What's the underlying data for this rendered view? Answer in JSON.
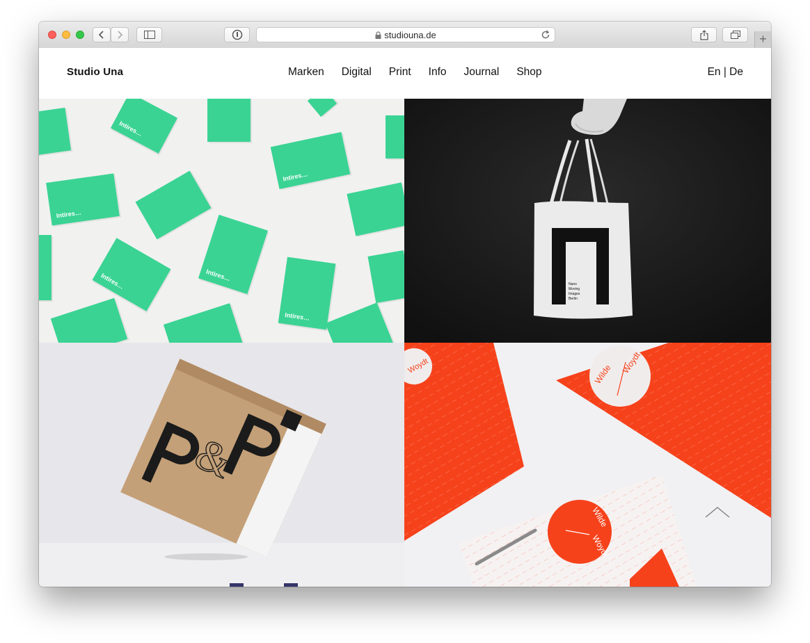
{
  "browser": {
    "url": "studiouna.de"
  },
  "site": {
    "logo": "Studio Una",
    "nav": [
      "Marken",
      "Digital",
      "Print",
      "Info",
      "Journal",
      "Shop"
    ],
    "lang": {
      "en": "En",
      "separator": " | ",
      "de": "De"
    }
  },
  "tiles": {
    "cards_text": "Intires…",
    "bag_text": [
      "Nano",
      "Moving",
      "Images",
      "Berlin"
    ],
    "bag_side": "nano",
    "circle_words": [
      "Wilde",
      "Woydt"
    ]
  },
  "colors": {
    "card_green": "#3ad393",
    "accent_orange": "#f6421b",
    "bag_black": "#111111",
    "box_kraft": "#c4a078"
  },
  "icons": {
    "scroll_top": "chevron-up-icon"
  }
}
